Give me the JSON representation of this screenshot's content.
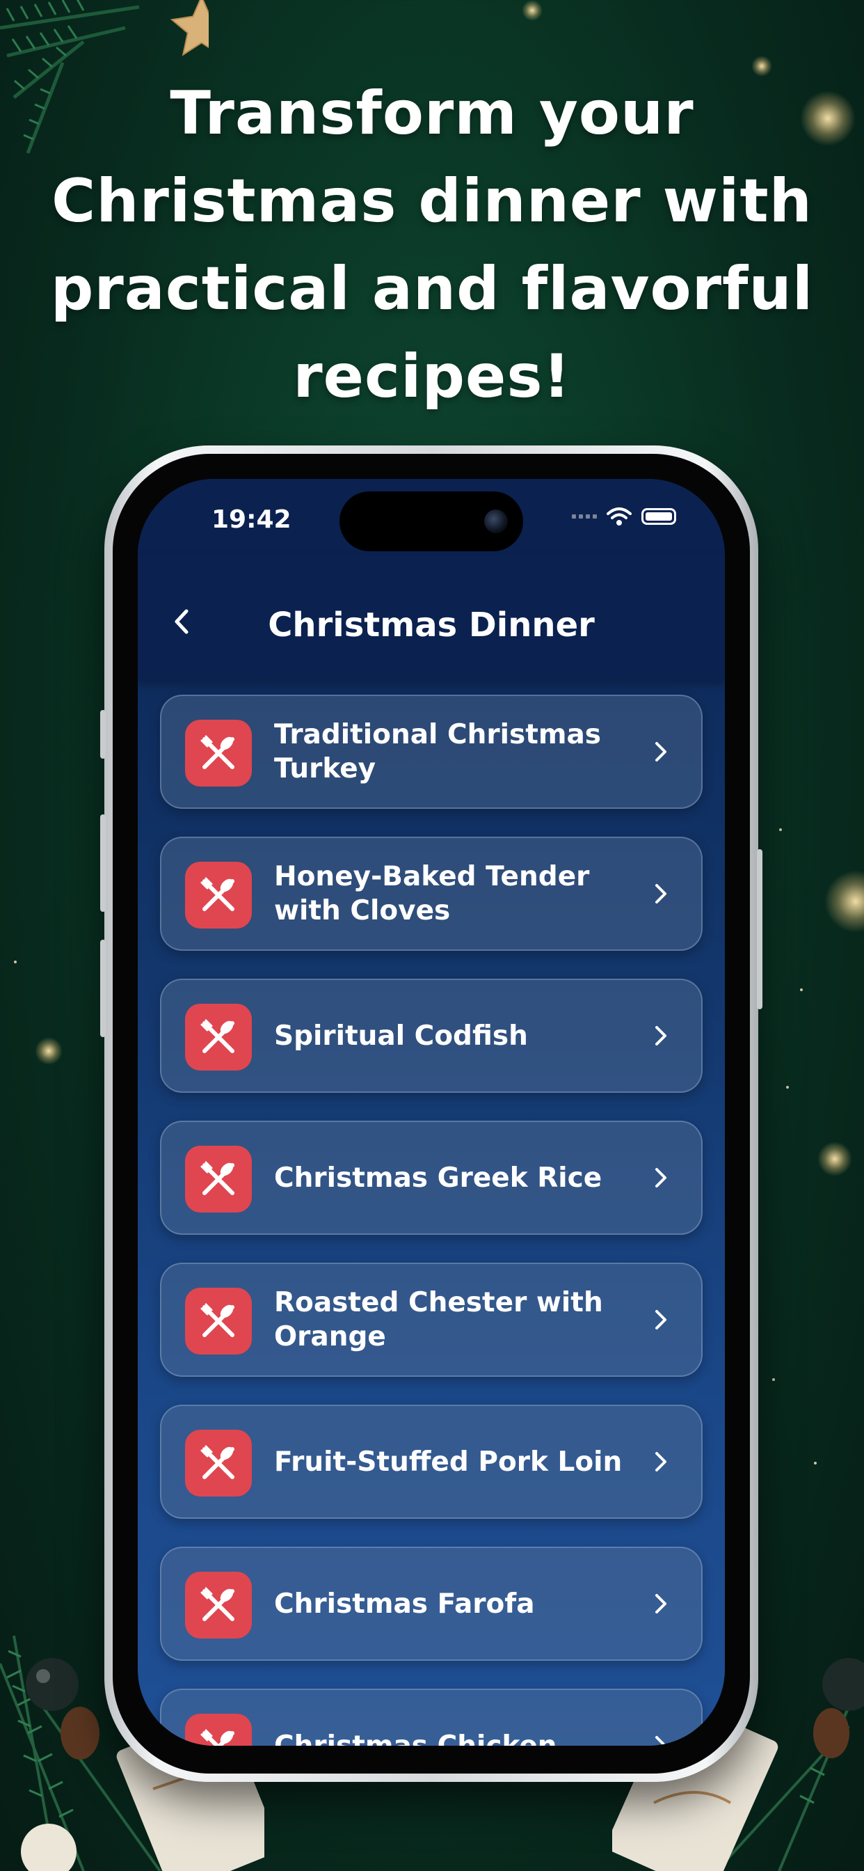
{
  "headline": "Transform your Christmas dinner with practical and flavorful recipes!",
  "status_bar": {
    "time": "19:42"
  },
  "nav": {
    "title": "Christmas Dinner"
  },
  "recipes": [
    {
      "label": "Traditional Christmas Turkey"
    },
    {
      "label": "Honey-Baked Tender with Cloves"
    },
    {
      "label": "Spiritual Codfish"
    },
    {
      "label": "Christmas Greek Rice"
    },
    {
      "label": "Roasted Chester with Orange"
    },
    {
      "label": "Fruit-Stuffed Pork Loin"
    },
    {
      "label": "Christmas Farofa"
    },
    {
      "label": "Christmas Chicken"
    }
  ],
  "icons": {
    "recipe_icon": "fork-spoon-icon",
    "chevron": "chevron-right-icon",
    "back": "chevron-left-icon"
  },
  "colors": {
    "background": "#0b3a28",
    "screen": "#123468",
    "accent": "#e0464f"
  }
}
